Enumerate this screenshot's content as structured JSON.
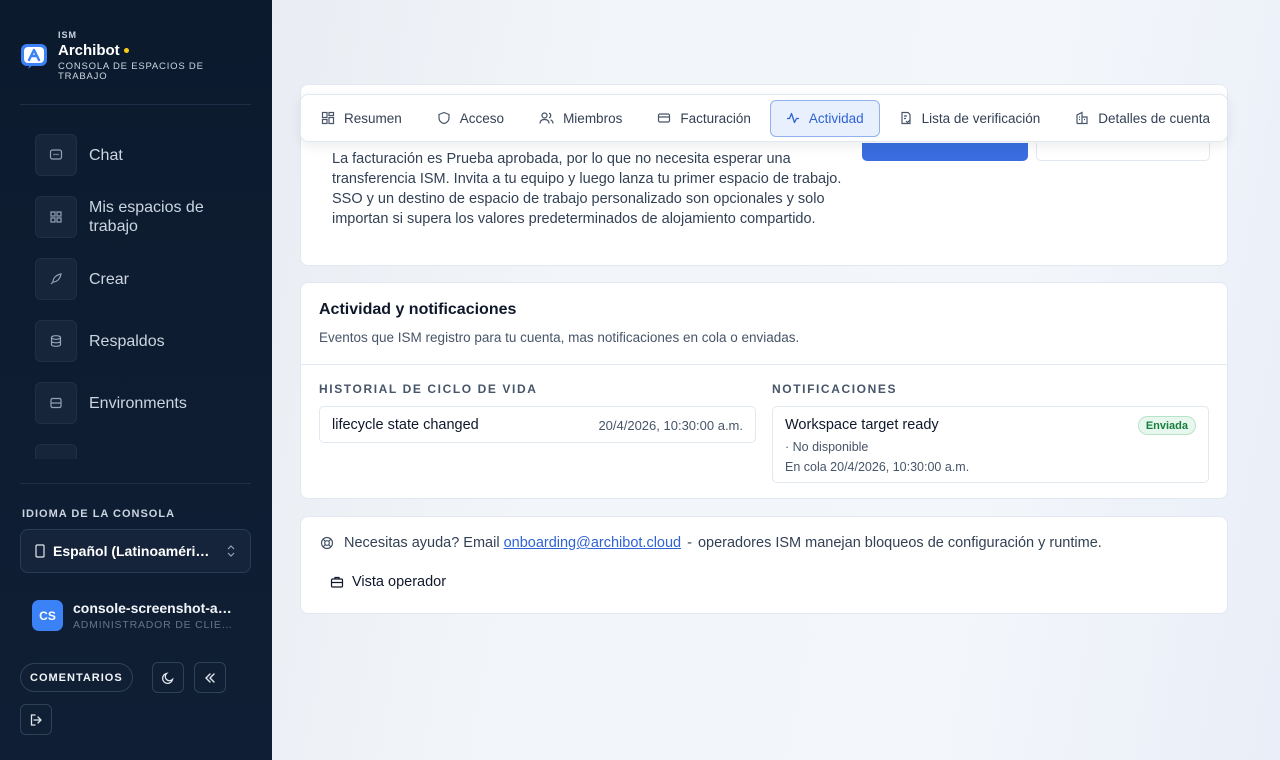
{
  "brand": {
    "small": "ISM",
    "name": "Archibot",
    "subtitle": "CONSOLA DE ESPACIOS DE TRABAJO"
  },
  "nav": {
    "items": [
      {
        "label": "Chat",
        "icon": "chat-icon"
      },
      {
        "label": "Mis espacios de trabajo",
        "icon": "grid-icon"
      },
      {
        "label": "Crear",
        "icon": "rocket-icon"
      },
      {
        "label": "Respaldos",
        "icon": "database-icon"
      },
      {
        "label": "Environments",
        "icon": "server-icon"
      }
    ]
  },
  "language": {
    "title": "IDIOMA DE LA CONSOLA",
    "value": "Español (Latinoamérica)"
  },
  "user": {
    "initials": "CS",
    "name": "console-screenshot-admin",
    "role": "ADMINISTRADOR DE CLIENTE"
  },
  "footer": {
    "feedback_label": "COMENTARIOS"
  },
  "tabs": [
    {
      "label": "Resumen",
      "icon": "grid-icon",
      "active": false
    },
    {
      "label": "Acceso",
      "icon": "shield-icon",
      "active": false
    },
    {
      "label": "Miembros",
      "icon": "users-icon",
      "active": false
    },
    {
      "label": "Facturación",
      "icon": "credit-card-icon",
      "active": false
    },
    {
      "label": "Actividad",
      "icon": "activity-icon",
      "active": true
    },
    {
      "label": "Lista de verificación",
      "icon": "checklist-icon",
      "active": false
    },
    {
      "label": "Detalles de cuenta",
      "icon": "building-icon",
      "active": false
    }
  ],
  "onboarding": {
    "body": "La facturación es Prueba aprobada, por lo que no necesita esperar una transferencia ISM. Invita a tu equipo y luego lanza tu primer espacio de trabajo. SSO y un destino de espacio de trabajo personalizado son opcionales y solo importan si supera los valores predeterminados de alojamiento compartido."
  },
  "activity": {
    "title": "Actividad y notificaciones",
    "subtitle": "Eventos que ISM registro para tu cuenta, mas notificaciones en cola o enviadas.",
    "lifecycle_title": "HISTORIAL DE CICLO DE VIDA",
    "lifecycle": [
      {
        "event": "lifecycle state changed",
        "date": "20/4/2026, 10:30:00 a.m."
      }
    ],
    "notifications_title": "NOTIFICACIONES",
    "notifications": [
      {
        "title": "Workspace target ready",
        "status": "Enviada",
        "detail": "· No disponible",
        "queued": "En cola 20/4/2026, 10:30:00 a.m."
      }
    ]
  },
  "help": {
    "prefix": "Necesitas ayuda? Email",
    "email": "onboarding@archibot.cloud",
    "sep": "-",
    "suffix": "operadores ISM manejan bloqueos de configuración y runtime.",
    "operator_label": "Vista operador"
  },
  "colors": {
    "accent": "#2f63d6",
    "sidebar": "#0c1a2e",
    "success": "#15803d"
  }
}
